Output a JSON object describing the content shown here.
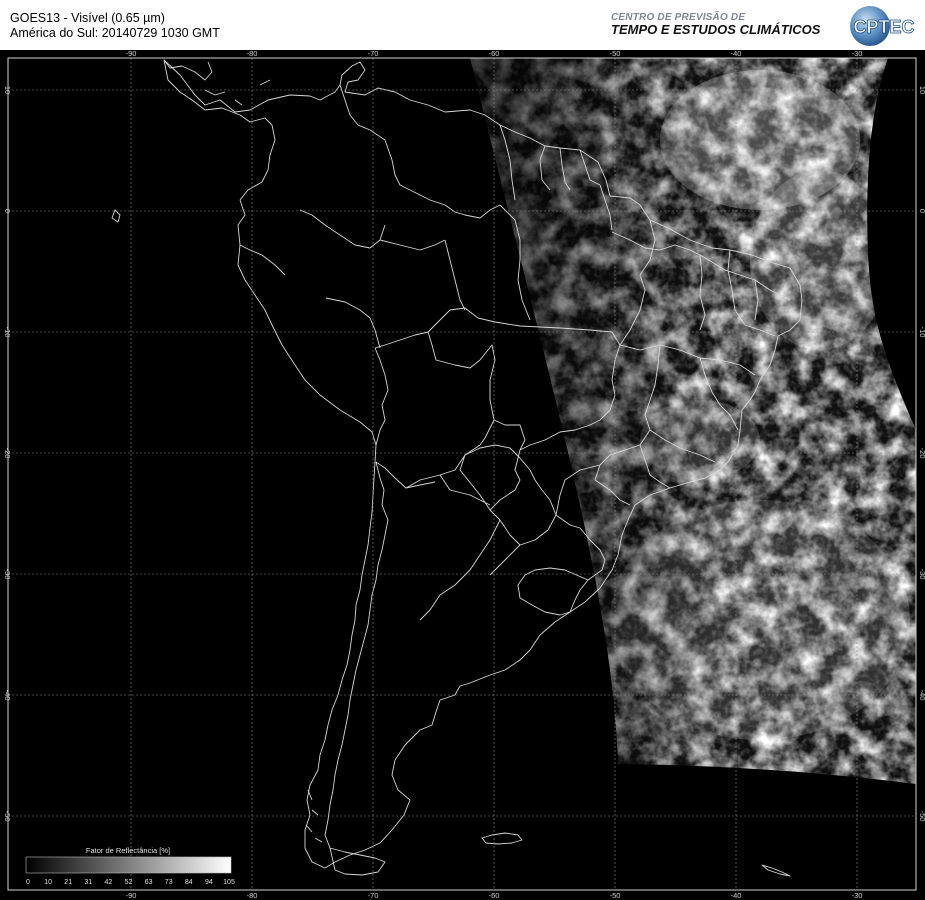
{
  "header": {
    "title_line1": "GOES13 - Visível (0.65 µm)",
    "title_line2": "América do Sul: 20140729 1030 GMT",
    "org_line1": "CENTRO DE PREVISÃO DE",
    "org_line2": "TEMPO E ESTUDOS CLIMÁTICOS",
    "logo_text": "CPTEC"
  },
  "map": {
    "lon_ticks": [
      "-90",
      "-80",
      "-70",
      "-60",
      "-50",
      "-40",
      "-30"
    ],
    "lat_ticks": [
      "10",
      "0",
      "-10",
      "-20",
      "-30",
      "-40",
      "-50"
    ]
  },
  "colorbar": {
    "title": "Fator de Reflectância [%]",
    "ticks": [
      "0",
      "10",
      "21",
      "31",
      "42",
      "52",
      "63",
      "73",
      "84",
      "94",
      "105"
    ]
  },
  "colors": {
    "background": "#000000",
    "border_lines": "#d8d8d8",
    "grid": "#8a8a8a",
    "org_accent": "#7f8794"
  }
}
